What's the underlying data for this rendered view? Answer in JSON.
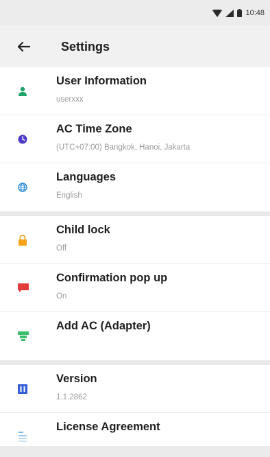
{
  "status_bar": {
    "time": "10:48",
    "icons": [
      "wifi-icon",
      "signal-icon",
      "battery-icon"
    ]
  },
  "header": {
    "title": "Settings",
    "back_icon": "back-arrow-icon"
  },
  "settings": [
    {
      "title": "User Information",
      "subtitle": "userxxx",
      "icon": "user-icon",
      "color": "#1fa36a"
    },
    {
      "title": "AC Time Zone",
      "subtitle": "(UTC+07:00) Bangkok, Hanoi, Jakarta",
      "icon": "clock-icon",
      "color": "#4c3cc9"
    },
    {
      "title": "Languages",
      "subtitle": "English",
      "icon": "globe-icon",
      "color": "#2f8fde"
    },
    {
      "title": "Child lock",
      "subtitle": "Off",
      "icon": "lock-icon",
      "color": "#f2a51a"
    },
    {
      "title": "Confirmation pop up",
      "subtitle": "On",
      "icon": "message-icon",
      "color": "#e23b3b"
    },
    {
      "title": "Add AC (Adapter)",
      "subtitle": "",
      "icon": "adapter-icon",
      "color": "#3bbf6a"
    },
    {
      "title": "Version",
      "subtitle": "1.1.2862",
      "icon": "info-icon",
      "color": "#3560d6"
    },
    {
      "title": "License Agreement",
      "subtitle": "",
      "icon": "document-icon",
      "color": "#7fb8e6"
    }
  ]
}
